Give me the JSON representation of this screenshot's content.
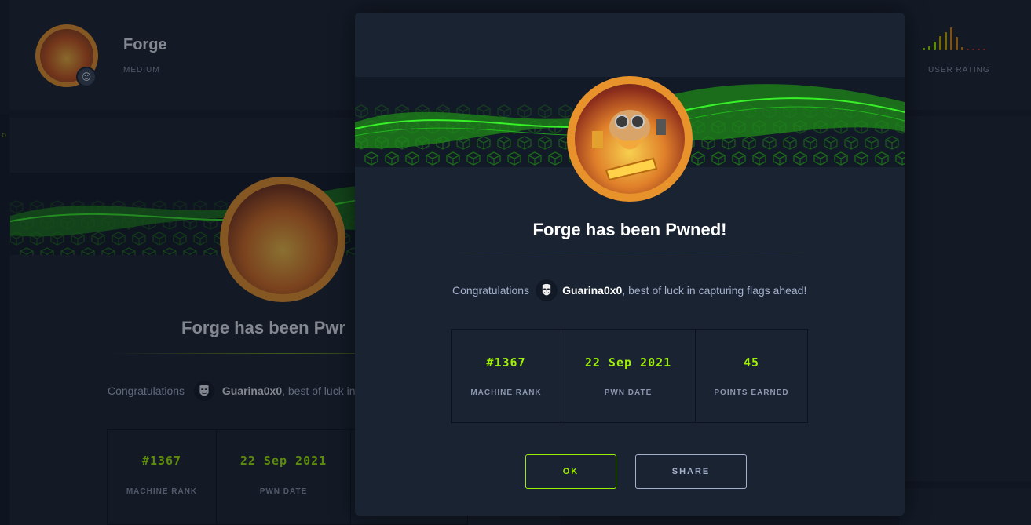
{
  "machine": {
    "name": "Forge",
    "difficulty": "MEDIUM"
  },
  "rating": {
    "label": "USER RATING",
    "bars": [
      {
        "level": 0.1,
        "color": "#9fef00"
      },
      {
        "level": 0.18,
        "color": "#9fef00"
      },
      {
        "level": 0.35,
        "color": "#9fef00"
      },
      {
        "level": 0.6,
        "color": "#c9b000"
      },
      {
        "level": 0.75,
        "color": "#c9b000"
      },
      {
        "level": 0.95,
        "color": "#d88b1d"
      },
      {
        "level": 0.55,
        "color": "#d88b1d"
      },
      {
        "level": 0.12,
        "color": "#d88b1d"
      },
      {
        "level": 0.05,
        "color": "#b22e2e"
      },
      {
        "level": 0.05,
        "color": "#b22e2e"
      },
      {
        "level": 0.05,
        "color": "#b22e2e"
      },
      {
        "level": 0.05,
        "color": "#b22e2e"
      }
    ]
  },
  "modal": {
    "title": "Forge has been Pwned!",
    "congrats_prefix": "Congratulations",
    "username": "Guarina0x0",
    "congrats_suffix": ", best of luck in capturing flags ahead!",
    "stats": [
      {
        "value": "#1367",
        "label": "MACHINE RANK"
      },
      {
        "value": "22 Sep 2021",
        "label": "PWN DATE"
      },
      {
        "value": "45",
        "label": "POINTS EARNED"
      }
    ],
    "ok_label": "OK",
    "share_label": "SHARE"
  },
  "background_modal": {
    "title": "Forge has been Pwr",
    "congrats_prefix": "Congratulations",
    "username": "Guarina0x0",
    "congrats_suffix": ", best of luck in",
    "stats": [
      {
        "value": "#1367",
        "label": "MACHINE RANK"
      },
      {
        "value": "22 Sep 2021",
        "label": "PWN DATE"
      }
    ]
  },
  "colors": {
    "accent": "#9fef00",
    "avatar_ring": "#e8922c",
    "background": "#141d2b",
    "panel": "#1a2332"
  }
}
